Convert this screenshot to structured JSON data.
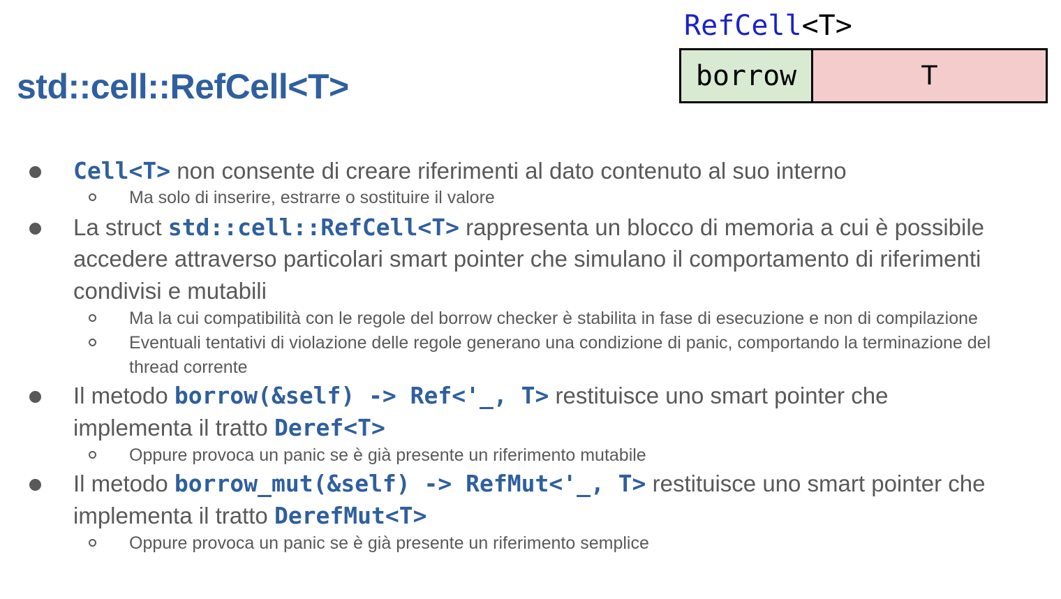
{
  "slide": {
    "title": "std::cell::RefCell<T>"
  },
  "diagram": {
    "title_code": "RefCell",
    "title_generic": "<T>",
    "cell_borrow": "borrow",
    "cell_value": "T",
    "colors": {
      "borrow_fill": "#d9ead3",
      "value_fill": "#f4cccc",
      "title_blue": "#1a22c8"
    }
  },
  "bullets": [
    {
      "parts": [
        "",
        "Cell<T>",
        " non consente di creare riferimenti al dato contenuto al suo interno"
      ],
      "subs": [
        "Ma solo di inserire, estrarre o sostituire il valore"
      ]
    },
    {
      "parts": [
        "La struct ",
        "std::cell::RefCell<T>",
        " rappresenta un blocco di memoria a cui è possibile accedere attraverso particolari smart pointer che simulano il comportamento di riferimenti condivisi e mutabili"
      ],
      "subs": [
        "Ma la cui compatibilità con le regole del borrow checker è stabilita in fase di esecuzione e non di compilazione",
        "Eventuali tentativi di violazione delle regole generano una condizione di panic, comportando la terminazione del thread corrente"
      ]
    },
    {
      "parts": [
        "Il metodo ",
        "borrow(&self) -> Ref<'_, T>",
        " restituisce uno smart pointer che implementa il tratto ",
        "Deref<T>",
        ""
      ],
      "subs": [
        "Oppure provoca un panic se è già presente un riferimento mutabile"
      ]
    },
    {
      "parts": [
        "Il metodo ",
        "borrow_mut(&self) -> RefMut<'_, T>",
        " restituisce uno smart pointer che implementa il tratto ",
        "DerefMut<T>",
        ""
      ],
      "subs": [
        "Oppure provoca un panic se è già presente un riferimento semplice"
      ]
    }
  ],
  "colors": {
    "title": "#2f5f9e",
    "body_text": "#595959",
    "code": "#2f5f9e"
  }
}
